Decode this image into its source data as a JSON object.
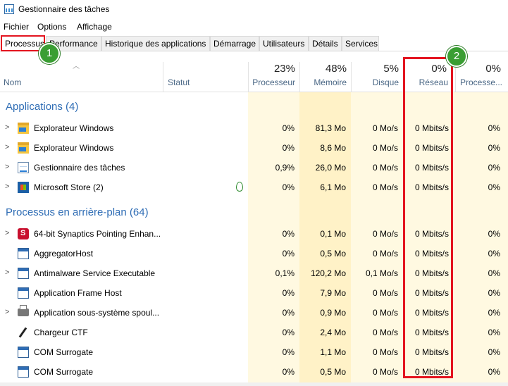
{
  "window": {
    "title": "Gestionnaire des tâches"
  },
  "menu": [
    "Fichier",
    "Options",
    "Affichage"
  ],
  "tabs": [
    "Processus",
    "Performance",
    "Historique des applications",
    "Démarrage",
    "Utilisateurs",
    "Détails",
    "Services"
  ],
  "badges": [
    "1",
    "2"
  ],
  "columns": {
    "name": "Nom",
    "status": "Statut",
    "cpu": {
      "pct": "23%",
      "label": "Processeur"
    },
    "memory": {
      "pct": "48%",
      "label": "Mémoire"
    },
    "disk": {
      "pct": "5%",
      "label": "Disque"
    },
    "network": {
      "pct": "0%",
      "label": "Réseau"
    },
    "gpu": {
      "pct": "0%",
      "label": "Processe..."
    }
  },
  "groups": {
    "apps": "Applications (4)",
    "background": "Processus en arrière-plan (64)"
  },
  "apps": [
    {
      "name": "Explorateur Windows",
      "cpu": "0%",
      "mem": "81,3 Mo",
      "disk": "0 Mo/s",
      "net": "0 Mbits/s",
      "gpu": "0%",
      "icon": "folder-icon"
    },
    {
      "name": "Explorateur Windows",
      "cpu": "0%",
      "mem": "8,6 Mo",
      "disk": "0 Mo/s",
      "net": "0 Mbits/s",
      "gpu": "0%",
      "icon": "folder-icon"
    },
    {
      "name": "Gestionnaire des tâches",
      "cpu": "0,9%",
      "mem": "26,0 Mo",
      "disk": "0 Mo/s",
      "net": "0 Mbits/s",
      "gpu": "0%",
      "icon": "task-manager-icon"
    },
    {
      "name": "Microsoft Store (2)",
      "cpu": "0%",
      "mem": "6,1 Mo",
      "disk": "0 Mo/s",
      "net": "0 Mbits/s",
      "gpu": "0%",
      "icon": "store-icon"
    }
  ],
  "background": [
    {
      "name": "64-bit Synaptics Pointing Enhan...",
      "cpu": "0%",
      "mem": "0,1 Mo",
      "disk": "0 Mo/s",
      "net": "0 Mbits/s",
      "gpu": "0%",
      "icon": "synaptics-icon"
    },
    {
      "name": "AggregatorHost",
      "cpu": "0%",
      "mem": "0,5 Mo",
      "disk": "0 Mo/s",
      "net": "0 Mbits/s",
      "gpu": "0%",
      "icon": "window-icon"
    },
    {
      "name": "Antimalware Service Executable",
      "cpu": "0,1%",
      "mem": "120,2 Mo",
      "disk": "0,1 Mo/s",
      "net": "0 Mbits/s",
      "gpu": "0%",
      "icon": "window-icon"
    },
    {
      "name": "Application Frame Host",
      "cpu": "0%",
      "mem": "7,9 Mo",
      "disk": "0 Mo/s",
      "net": "0 Mbits/s",
      "gpu": "0%",
      "icon": "window-icon"
    },
    {
      "name": "Application sous-système spoul...",
      "cpu": "0%",
      "mem": "0,9 Mo",
      "disk": "0 Mo/s",
      "net": "0 Mbits/s",
      "gpu": "0%",
      "icon": "printer-icon"
    },
    {
      "name": "Chargeur CTF",
      "cpu": "0%",
      "mem": "2,4 Mo",
      "disk": "0 Mo/s",
      "net": "0 Mbits/s",
      "gpu": "0%",
      "icon": "ctf-pen-icon"
    },
    {
      "name": "COM Surrogate",
      "cpu": "0%",
      "mem": "1,1 Mo",
      "disk": "0 Mo/s",
      "net": "0 Mbits/s",
      "gpu": "0%",
      "icon": "window-icon"
    },
    {
      "name": "COM Surrogate",
      "cpu": "0%",
      "mem": "0,5 Mo",
      "disk": "0 Mo/s",
      "net": "0 Mbits/s",
      "gpu": "0%",
      "icon": "window-icon"
    }
  ],
  "colors": {
    "accent": "#2f6db5",
    "highlight": "#e3141f",
    "badge": "#3a9e33",
    "cell_light": "#fff9e1",
    "cell_medium": "#fff2c7"
  }
}
